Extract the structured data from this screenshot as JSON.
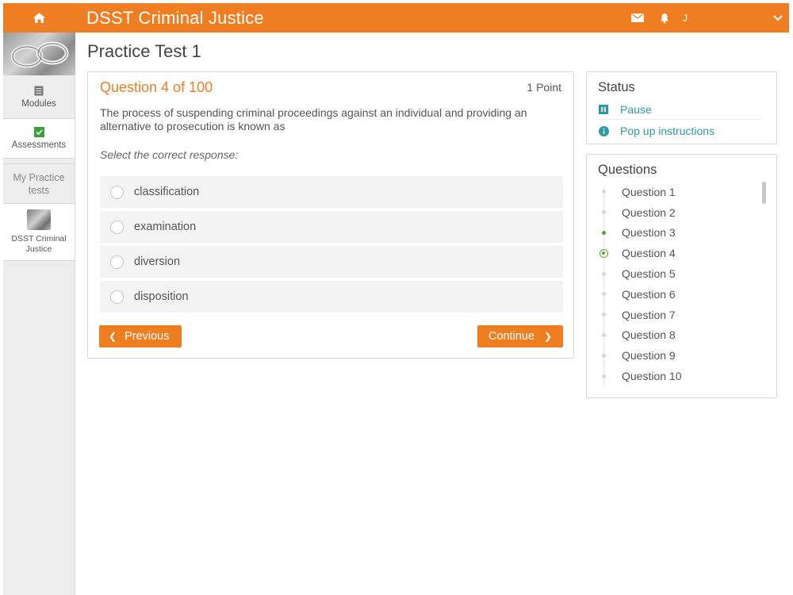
{
  "header": {
    "title": "DSST Criminal Justice",
    "user_initial": "J",
    "icons": [
      "home-icon",
      "mail-icon",
      "bell-icon",
      "chevron-down-icon"
    ],
    "color": "#ef7d22"
  },
  "sidebar": {
    "items": [
      {
        "label": "Modules",
        "icon": "modules-icon"
      },
      {
        "label": "Assessments",
        "icon": "check-icon"
      },
      {
        "label": "My Practice tests"
      },
      {
        "label": "DSST Criminal Justice"
      }
    ]
  },
  "page": {
    "title": "Practice Test 1"
  },
  "question": {
    "header": "Question 4 of 100",
    "points": "1 Point",
    "text": "The process of suspending criminal proceedings against an individual and providing an alternative to prosecution is known as",
    "instruction": "Select the correct response:",
    "options": [
      "classification",
      "examination",
      "diversion",
      "disposition"
    ],
    "prev_label": "Previous",
    "next_label": "Continue"
  },
  "status": {
    "title": "Status",
    "pause_label": "Pause",
    "instructions_label": "Pop up instructions",
    "accent": "#2f9aa0"
  },
  "questions_panel": {
    "title": "Questions",
    "items": [
      "Question 1",
      "Question 2",
      "Question 3",
      "Question 4",
      "Question 5",
      "Question 6",
      "Question 7",
      "Question 8",
      "Question 9",
      "Question 10"
    ],
    "answered": [
      "Question 3"
    ],
    "current": "Question 4",
    "progress_color": "#5aa53a"
  }
}
